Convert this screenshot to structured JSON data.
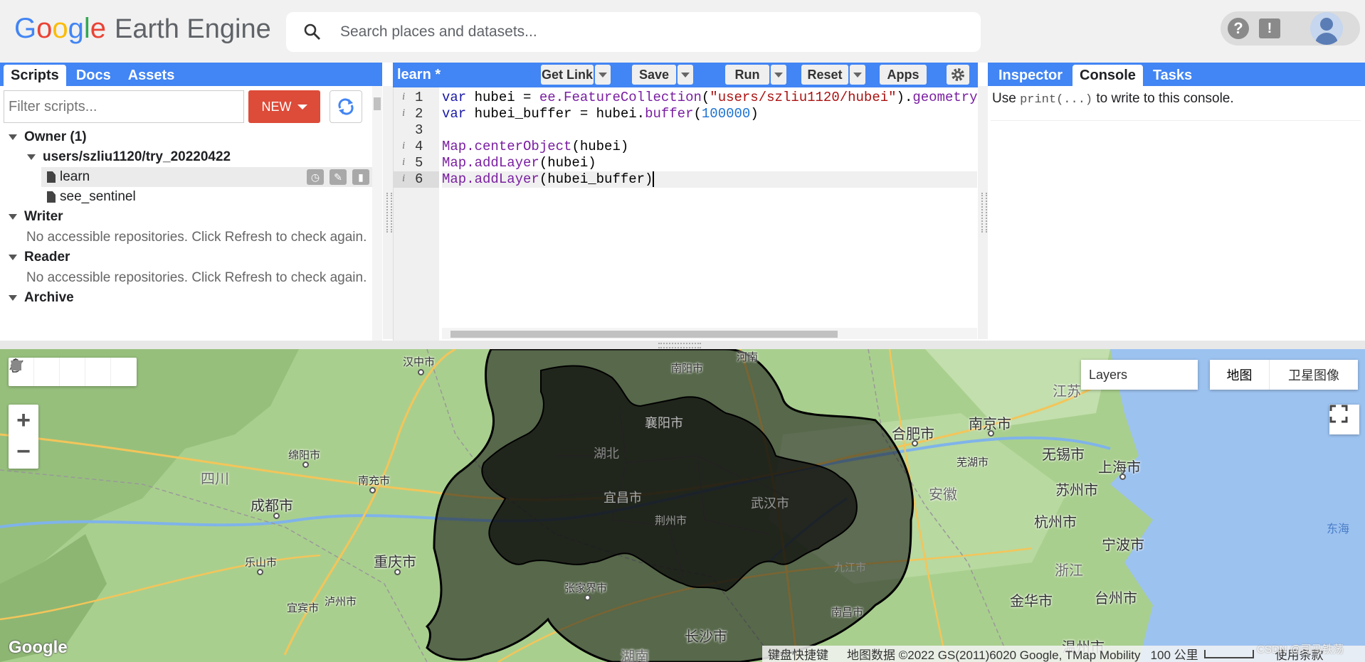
{
  "header": {
    "logo_letters": [
      "G",
      "o",
      "o",
      "g",
      "l",
      "e"
    ],
    "product_name": "Earth Engine",
    "search_placeholder": "Search places and datasets...",
    "help_icon": "help-icon",
    "feedback_icon": "feedback-icon",
    "avatar_icon": "user-avatar-icon"
  },
  "left_panel": {
    "tabs": [
      {
        "label": "Scripts",
        "active": true
      },
      {
        "label": "Docs",
        "active": false
      },
      {
        "label": "Assets",
        "active": false
      }
    ],
    "filter_placeholder": "Filter scripts...",
    "new_label": "NEW",
    "tree": {
      "owner": "Owner (1)",
      "repo": "users/szliu1120/try_20220422",
      "files": [
        "learn",
        "see_sentinel"
      ],
      "writer": "Writer",
      "writer_msg": "No accessible repositories. Click Refresh to check again.",
      "reader": "Reader",
      "reader_msg": "No accessible repositories. Click Refresh to check again.",
      "archive": "Archive"
    }
  },
  "editor": {
    "title": "learn *",
    "toolbar": {
      "get_link": "Get Link",
      "save": "Save",
      "run": "Run",
      "reset": "Reset",
      "apps": "Apps"
    },
    "line_numbers": [
      "1",
      "2",
      "3",
      "4",
      "5",
      "6"
    ],
    "info_marker": "i"
  },
  "right_panel": {
    "tabs": [
      {
        "label": "Inspector",
        "active": false
      },
      {
        "label": "Console",
        "active": true
      },
      {
        "label": "Tasks",
        "active": false
      }
    ],
    "console_hint_pre": "Use ",
    "console_hint_code": "print(...)",
    "console_hint_post": " to write to this console."
  },
  "map": {
    "layers_label": "Layers",
    "maptype_map": "地图",
    "maptype_satellite": "卫星图像",
    "zoom_in": "+",
    "zoom_out": "−",
    "google_logo": "Google",
    "attribution": {
      "shortcuts": "键盘快捷键",
      "data": "地图数据 ©2022 GS(2011)6020 Google, TMap Mobility",
      "scale": "100 公里",
      "terms": "使用条款"
    },
    "watermark": "CSDN @司马铁荡",
    "labels": {
      "hanzhong": "汉中市",
      "nanyang": "南阳市",
      "henan_partial": "河南",
      "xiangyang": "襄阳市",
      "hubei": "湖北",
      "yichang": "宜昌市",
      "wuhan": "武汉市",
      "jingzhou": "荆州市",
      "mianyang": "绵阳市",
      "sichuan": "四川",
      "nanchong": "南充市",
      "chengdu": "成都市",
      "leshan": "乐山市",
      "chongqing": "重庆市",
      "yibin": "宜宾市",
      "luzhou": "泸州市",
      "zhangjiajie": "张家界市",
      "changsha": "长沙市",
      "hunan": "湖南",
      "nanchang": "南昌市",
      "jiujiang": "九江市",
      "hefei": "合肥市",
      "anhui": "安徽",
      "wuhu": "芜湖市",
      "nanjing": "南京市",
      "jiangsu": "江苏",
      "wuxi": "无锡市",
      "suzhou": "苏州市",
      "shanghai": "上海市",
      "hangzhou": "杭州市",
      "ningbo": "宁波市",
      "zhejiang": "浙江",
      "jinhua": "金华市",
      "taizhou": "台州市",
      "wenzhou": "温州市",
      "east_sea": "东海"
    }
  }
}
